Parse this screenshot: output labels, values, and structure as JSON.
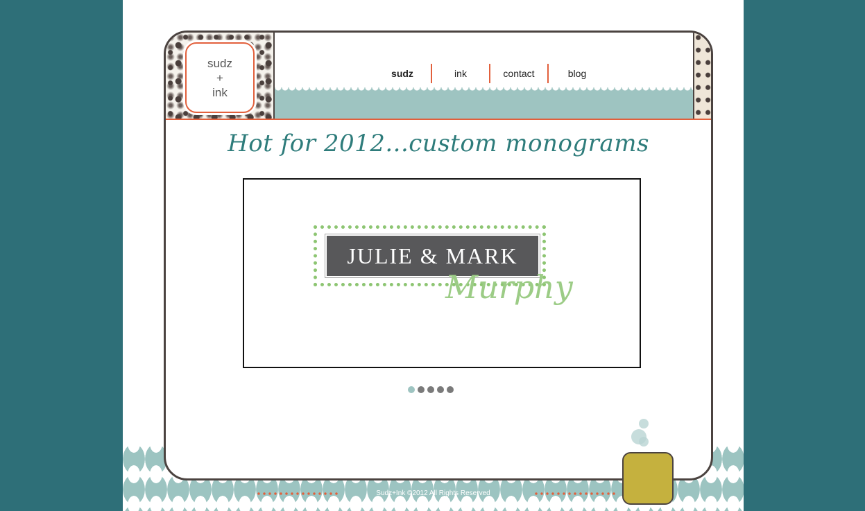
{
  "logo": {
    "line1": "sudz",
    "line2": "+",
    "line3": "ink"
  },
  "nav": {
    "items": [
      {
        "label": "sudz",
        "active": true
      },
      {
        "label": "ink",
        "active": false
      },
      {
        "label": "contact",
        "active": false
      },
      {
        "label": "blog",
        "active": false
      }
    ]
  },
  "main": {
    "title": "Hot for 2012...custom monograms",
    "slide": {
      "name": "JULIE & MARK",
      "surname": "Murphy"
    },
    "slide_dots": {
      "count": 5,
      "active_index": 0
    }
  },
  "footer": {
    "copyright": "Sudz+Ink ©2012 All Rights Reserved"
  },
  "colors": {
    "background": "#2e6f78",
    "accent": "#e2603c",
    "band": "#9ec4c1",
    "title": "#2e7c7b",
    "monogram_green": "#8dc572",
    "tag": "#c5b13e"
  }
}
